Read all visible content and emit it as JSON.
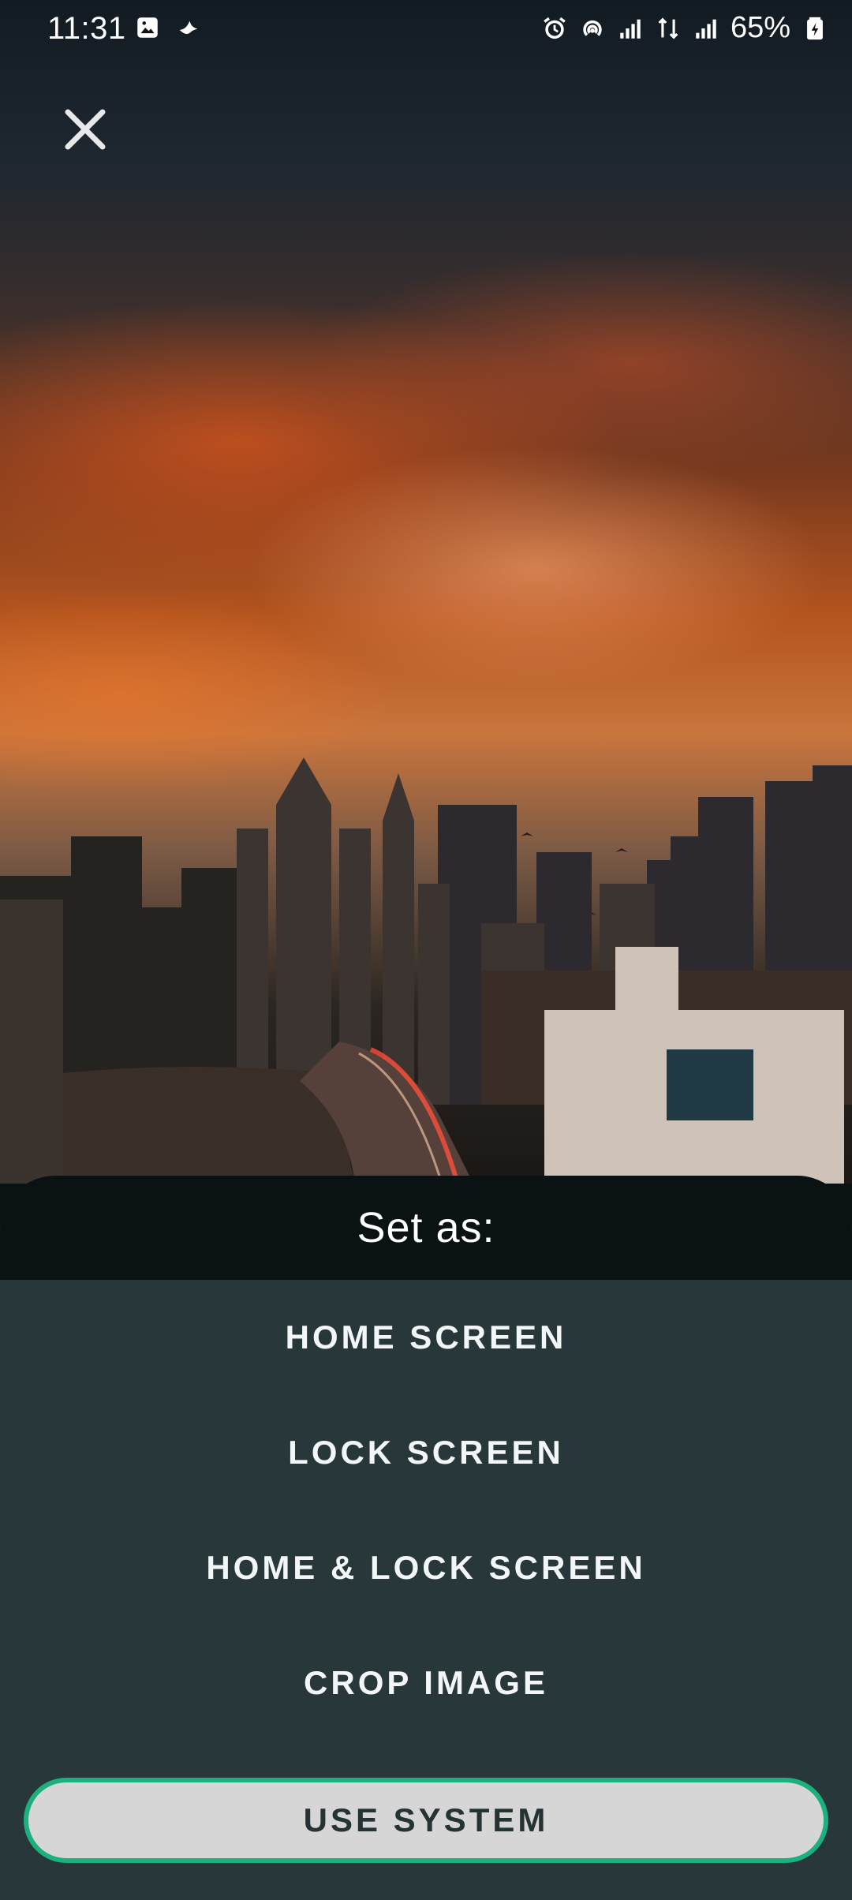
{
  "status_bar": {
    "time": "11:31",
    "battery": "65%",
    "left_icons": [
      "gallery-icon",
      "bird-icon"
    ],
    "right_icons": [
      "alarm-icon",
      "hotspot-icon",
      "signal-icon",
      "data-arrows-icon",
      "signal-icon",
      "battery-icon"
    ]
  },
  "toolbar": {
    "close_icon": "close-icon"
  },
  "sheet": {
    "title": "Set as:",
    "options": [
      {
        "label": "HOME SCREEN"
      },
      {
        "label": "LOCK SCREEN"
      },
      {
        "label": "HOME & LOCK SCREEN"
      },
      {
        "label": "CROP IMAGE"
      }
    ],
    "primary": {
      "label": "USE SYSTEM"
    }
  },
  "colors": {
    "sheet_bg": "#28373a",
    "header_bg": "#0b1214",
    "accent": "#1bb07d",
    "button_bg": "#d6d6d6"
  }
}
